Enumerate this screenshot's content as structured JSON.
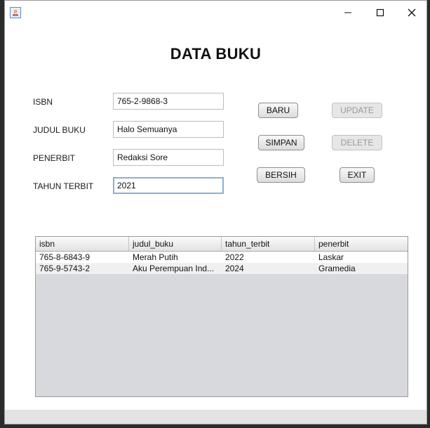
{
  "window": {
    "controls": {
      "minimize": "minimize-icon",
      "maximize": "maximize-icon",
      "close": "close-icon"
    }
  },
  "form": {
    "title": "DATA BUKU",
    "fields": [
      {
        "label": "ISBN",
        "value": "765-2-9868-3"
      },
      {
        "label": "JUDUL BUKU",
        "value": "Halo Semuanya"
      },
      {
        "label": "PENERBIT",
        "value": "Redaksi Sore"
      },
      {
        "label": "TAHUN TERBIT",
        "value": "2021"
      }
    ]
  },
  "buttons": {
    "baru": "BARU",
    "update": "UPDATE",
    "simpan": "SIMPAN",
    "delete": "DELETE",
    "bersih": "BERSIH",
    "exit": "EXIT"
  },
  "table": {
    "columns": [
      "isbn",
      "judul_buku",
      "tahun_terbit",
      "penerbit"
    ],
    "rows": [
      [
        "765-8-6843-9",
        "Merah Putih",
        "2022",
        "Laskar"
      ],
      [
        "765-9-5743-2",
        "Aku Perempuan Ind...",
        "2024",
        "Gramedia"
      ]
    ]
  },
  "colors": {
    "focus_border": "#8bb0d6",
    "row_stripe": "#f0f0f0",
    "table_bg": "#d8d9dc"
  }
}
